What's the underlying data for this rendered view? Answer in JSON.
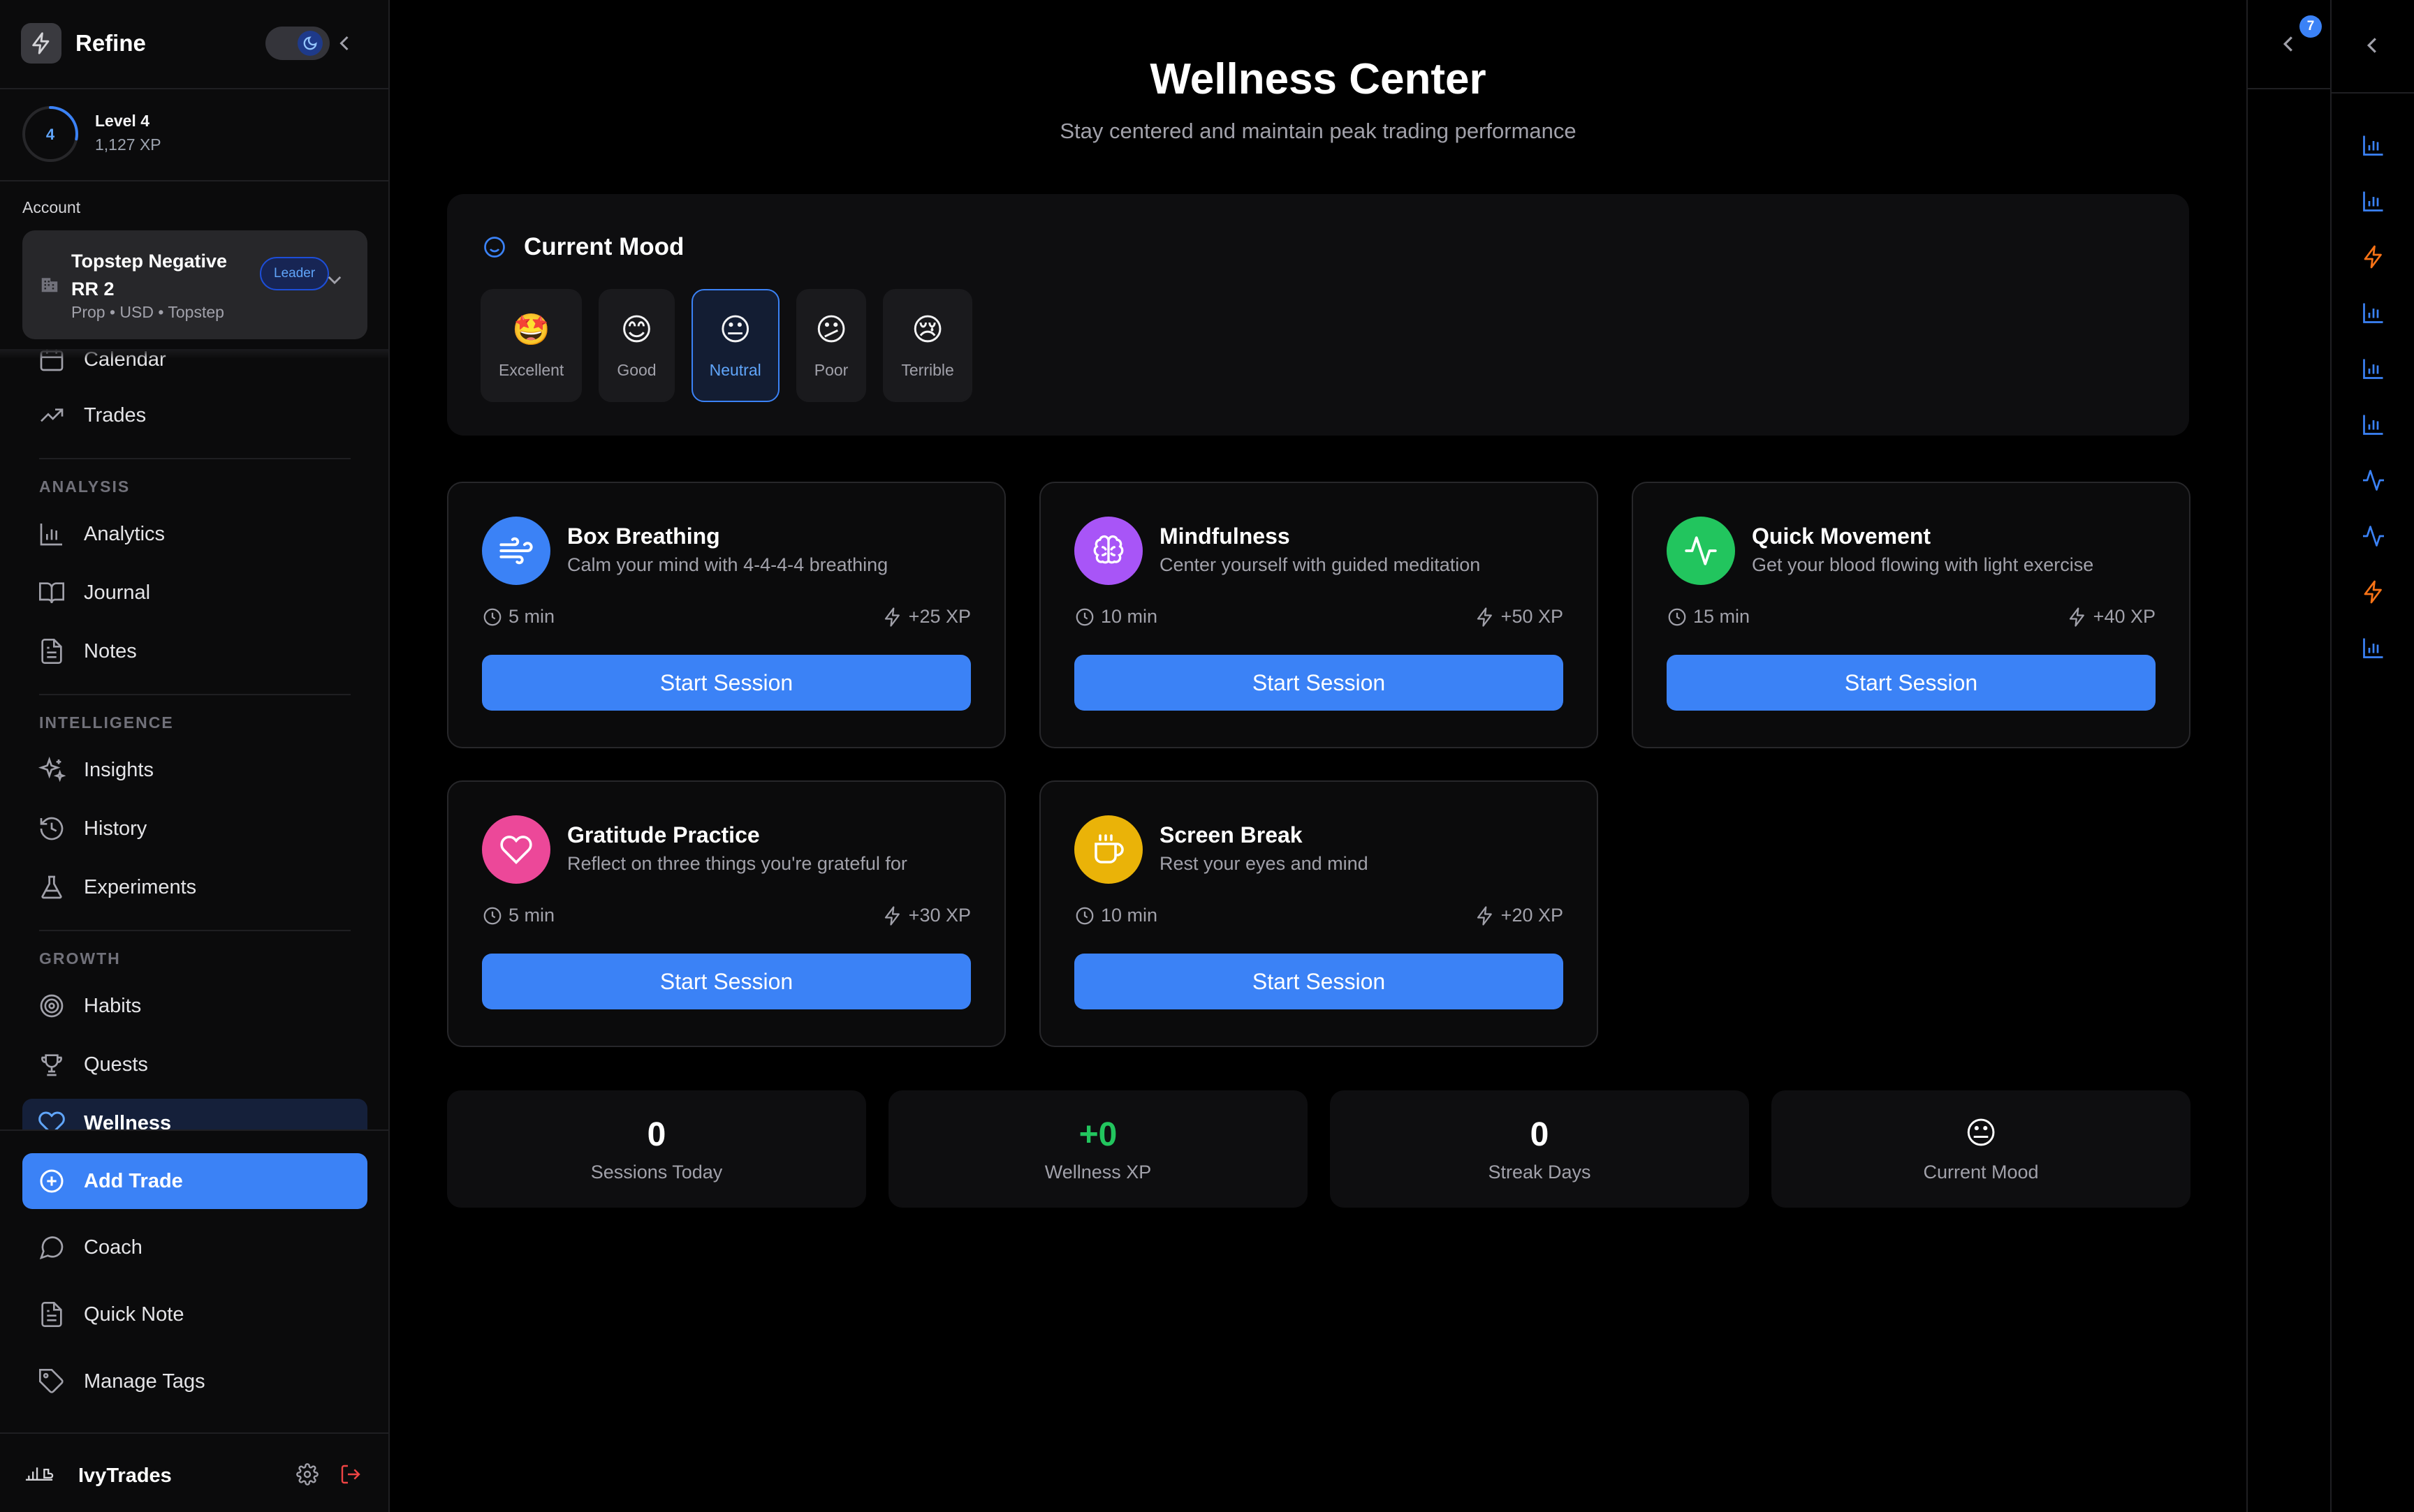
{
  "app": {
    "name": "Refine"
  },
  "level": {
    "number": "4",
    "title": "Level 4",
    "xp": "1,127 XP",
    "progress": 0.28
  },
  "account": {
    "label": "Account",
    "name": "Topstep Negative RR 2",
    "meta": "Prop • USD • Topstep",
    "badge": "Leader"
  },
  "nav": {
    "calendar": "Calendar",
    "trades": "Trades",
    "analysis_label": "ANALYSIS",
    "analytics": "Analytics",
    "journal": "Journal",
    "notes": "Notes",
    "intelligence_label": "INTELLIGENCE",
    "insights": "Insights",
    "history": "History",
    "experiments": "Experiments",
    "growth_label": "GROWTH",
    "habits": "Habits",
    "quests": "Quests",
    "wellness": "Wellness"
  },
  "actions": {
    "add_trade": "Add Trade",
    "coach": "Coach",
    "quick_note": "Quick Note",
    "manage_tags": "Manage Tags"
  },
  "user": {
    "name": "IvyTrades"
  },
  "page": {
    "title": "Wellness Center",
    "subtitle": "Stay centered and maintain peak trading performance"
  },
  "mood": {
    "heading": "Current Mood",
    "selected": "Neutral",
    "options": [
      {
        "emoji": "🤩",
        "label": "Excellent"
      },
      {
        "emoji": "😊",
        "label": "Good"
      },
      {
        "emoji": "😐",
        "label": "Neutral"
      },
      {
        "emoji": "😕",
        "label": "Poor"
      },
      {
        "emoji": "😢",
        "label": "Terrible"
      }
    ]
  },
  "exercises": [
    {
      "title": "Box Breathing",
      "desc": "Calm your mind with 4-4-4-4 breathing",
      "duration": "5 min",
      "xp": "+25 XP",
      "button": "Start Session",
      "icon": "wind-icon",
      "color": "#3b82f6"
    },
    {
      "title": "Mindfulness",
      "desc": "Center yourself with guided meditation",
      "duration": "10 min",
      "xp": "+50 XP",
      "button": "Start Session",
      "icon": "brain-icon",
      "color": "#a855f7"
    },
    {
      "title": "Quick Movement",
      "desc": "Get your blood flowing with light exercise",
      "duration": "15 min",
      "xp": "+40 XP",
      "button": "Start Session",
      "icon": "activity-icon",
      "color": "#22c55e"
    },
    {
      "title": "Gratitude Practice",
      "desc": "Reflect on three things you're grateful for",
      "duration": "5 min",
      "xp": "+30 XP",
      "button": "Start Session",
      "icon": "heart-icon",
      "color": "#ec4899"
    },
    {
      "title": "Screen Break",
      "desc": "Rest your eyes and mind",
      "duration": "10 min",
      "xp": "+20 XP",
      "button": "Start Session",
      "icon": "coffee-icon",
      "color": "#eab308"
    }
  ],
  "stats": [
    {
      "value": "0",
      "label": "Sessions Today"
    },
    {
      "value": "+0",
      "label": "Wellness XP",
      "color": "#22c55e"
    },
    {
      "value": "0",
      "label": "Streak Days"
    },
    {
      "value": "😐",
      "label": "Current Mood"
    }
  ],
  "notifications": {
    "count": "7"
  },
  "colors": {
    "accent": "#3b82f6",
    "background": "#000000",
    "card": "#0b0b0c",
    "orange": "#f97316"
  }
}
